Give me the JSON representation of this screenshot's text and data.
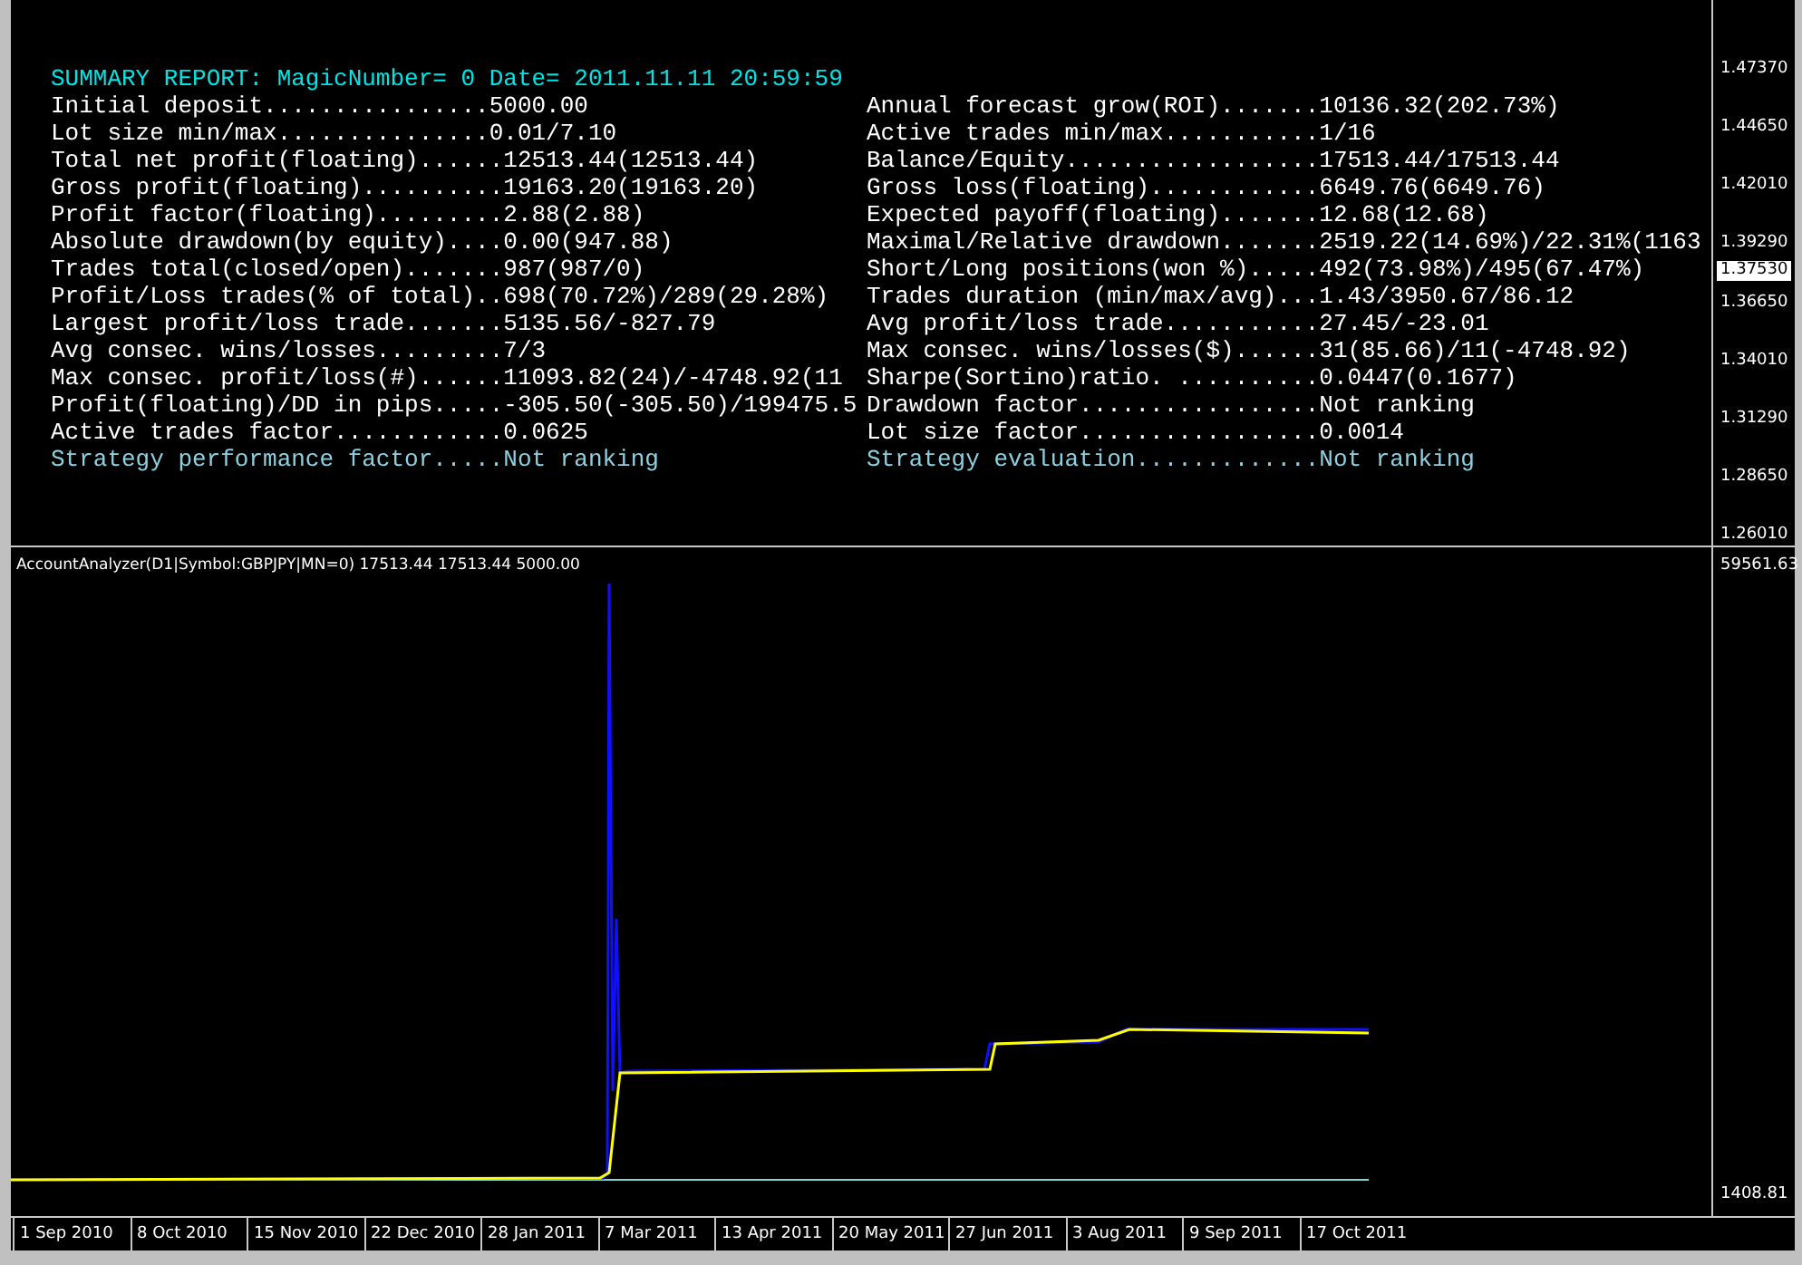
{
  "report": {
    "title": "SUMMARY REPORT: MagicNumber= 0 Date= 2011.11.11 20:59:59",
    "left": [
      {
        "text": "Initial deposit................5000.00",
        "kind": "stat"
      },
      {
        "text": "Lot size min/max...............0.01/7.10",
        "kind": "stat"
      },
      {
        "text": "Total net profit(floating)......12513.44(12513.44)",
        "kind": "stat"
      },
      {
        "text": "Gross profit(floating)..........19163.20(19163.20)",
        "kind": "stat"
      },
      {
        "text": "Profit factor(floating).........2.88(2.88)",
        "kind": "stat"
      },
      {
        "text": "Absolute drawdown(by equity)....0.00(947.88)",
        "kind": "stat"
      },
      {
        "text": "Trades total(closed/open).......987(987/0)",
        "kind": "stat"
      },
      {
        "text": "Profit/Loss trades(% of total)..698(70.72%)/289(29.28%)",
        "kind": "stat"
      },
      {
        "text": "Largest profit/loss trade.......5135.56/-827.79",
        "kind": "stat"
      },
      {
        "text": "Avg consec. wins/losses.........7/3",
        "kind": "stat"
      },
      {
        "text": "Max consec. profit/loss(#)......11093.82(24)/-4748.92(11",
        "kind": "stat"
      },
      {
        "text": "Profit(floating)/DD in pips.....-305.50(-305.50)/199475.5",
        "kind": "stat"
      },
      {
        "text": "Active trades factor............0.0625",
        "kind": "stat"
      },
      {
        "text": "Strategy performance factor.....Not ranking",
        "kind": "rating"
      }
    ],
    "right": [
      {
        "text": "Annual forecast grow(ROI).......10136.32(202.73%)",
        "kind": "stat"
      },
      {
        "text": "Active trades min/max...........1/16",
        "kind": "stat"
      },
      {
        "text": "Balance/Equity..................17513.44/17513.44",
        "kind": "stat"
      },
      {
        "text": "Gross loss(floating)............6649.76(6649.76)",
        "kind": "stat"
      },
      {
        "text": "Expected payoff(floating).......12.68(12.68)",
        "kind": "stat"
      },
      {
        "text": "Maximal/Relative drawdown.......2519.22(14.69%)/22.31%(1163",
        "kind": "stat"
      },
      {
        "text": "Short/Long positions(won %).....492(73.98%)/495(67.47%)",
        "kind": "stat"
      },
      {
        "text": "Trades duration (min/max/avg)...1.43/3950.67/86.12",
        "kind": "stat"
      },
      {
        "text": "Avg profit/loss trade...........27.45/-23.01",
        "kind": "stat"
      },
      {
        "text": "Max consec. wins/losses($)......31(85.66)/11(-4748.92)",
        "kind": "stat"
      },
      {
        "text": "Sharpe(Sortino)ratio. ..........0.0447(0.1677)",
        "kind": "stat"
      },
      {
        "text": "Drawdown factor.................Not ranking",
        "kind": "stat"
      },
      {
        "text": "Lot size factor.................0.0014",
        "kind": "stat"
      },
      {
        "text": "Strategy evaluation.............Not ranking",
        "kind": "rating"
      }
    ]
  },
  "price_axis": {
    "ticks": [
      "1.47370",
      "1.44650",
      "1.42010",
      "1.39290",
      "1.36650",
      "1.34010",
      "1.31290",
      "1.28650",
      "1.26010"
    ],
    "current_price": "1.37530"
  },
  "indicator": {
    "label": "AccountAnalyzer(D1|Symbol:GBPJPY|MN=0) 17513.44 17513.44 5000.00",
    "axis_max": "59561.63",
    "axis_min": "1408.81"
  },
  "time_axis": [
    "1 Sep 2010",
    "8 Oct 2010",
    "15 Nov 2010",
    "22 Dec 2010",
    "28 Jan 2011",
    "7 Mar 2011",
    "13 Apr 2011",
    "20 May 2011",
    "27 Jun 2011",
    "3 Aug 2011",
    "9 Sep 2011",
    "17 Oct 2011"
  ]
}
